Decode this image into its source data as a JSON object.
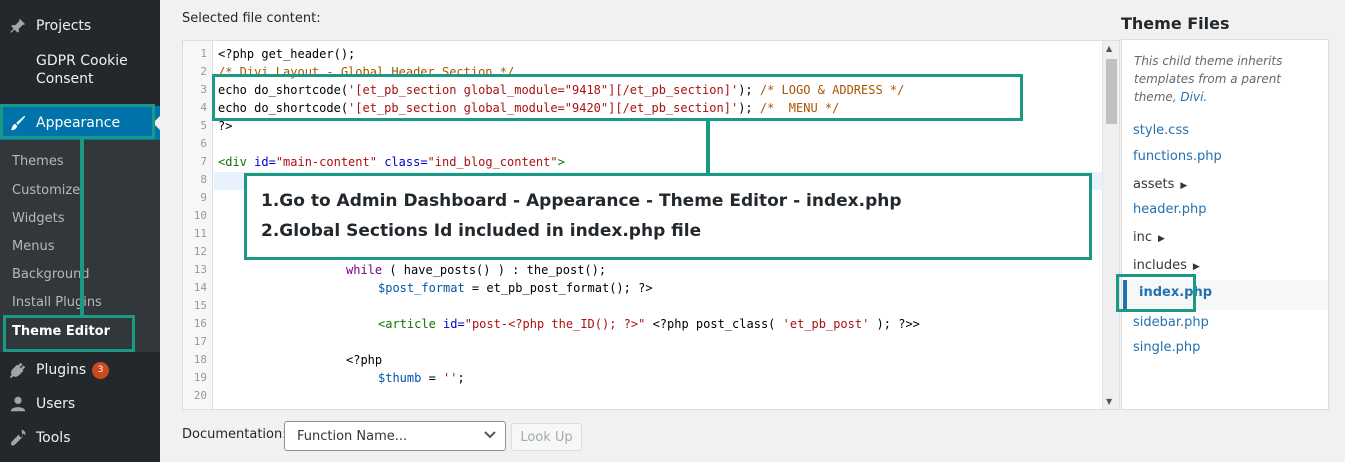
{
  "sidebar": {
    "projects": "Projects",
    "gdpr": "GDPR Cookie Consent",
    "appearance": "Appearance",
    "sub": [
      "Themes",
      "Customize",
      "Widgets",
      "Menus",
      "Background",
      "Install Plugins",
      "Theme Editor"
    ],
    "plugins": "Plugins",
    "plugins_badge": "3",
    "users": "Users",
    "tools": "Tools"
  },
  "editor": {
    "label": "Selected file content:",
    "line_numbers": [
      "1",
      "2",
      "3",
      "4",
      "5",
      "6",
      "7",
      "8",
      "9",
      "10",
      "11",
      "12",
      "13",
      "14",
      "15",
      "16",
      "17",
      "18",
      "19",
      "20"
    ],
    "lines": {
      "l1": "<?php get_header();",
      "l2": "/* Divi Layout - Global Header Section */",
      "l3a": "echo do_shortcode(",
      "l3b": "'[et_pb_section global_module=\"9418\"][/et_pb_section]'",
      "l3c": "); ",
      "l3d": "/* LOGO & ADDRESS */",
      "l4a": "echo do_shortcode(",
      "l4b": "'[et_pb_section global_module=\"9420\"][/et_pb_section]'",
      "l4c": "); ",
      "l4d": "/*  MENU */",
      "l5": "?>",
      "l7a": "<div ",
      "l7b": "id=",
      "l7c": "\"main-content\"",
      "l7d": " class=",
      "l7e": "\"ind_blog_content\"",
      "l7f": ">",
      "l13a": "while",
      "l13b": " ( have_posts() ) : the_post();",
      "l14a": "$post_format",
      "l14b": " = et_pb_post_format(); ?>",
      "l16a": "<article ",
      "l16b": "id=",
      "l16c": "\"post-<?php the_ID(); ?>\"",
      "l16d": " <?php post_class( ",
      "l16e": "'et_pb_post'",
      "l16f": " ); ?>>",
      "l18": "<?php",
      "l19a": "$thumb",
      "l19b": " = ",
      "l19c": "''",
      "l19d": ";"
    }
  },
  "callout": {
    "line1": "1.Go to Admin Dashboard - Appearance - Theme Editor - index.php",
    "line2": "2.Global Sections Id included in index.php file"
  },
  "documentation": {
    "label": "Documentation:",
    "select_value": "Function Name...",
    "button": "Look Up"
  },
  "theme_files": {
    "title": "Theme Files",
    "note": "This child theme inherits templates from a parent theme,",
    "note_link": "Divi.",
    "files": [
      "style.css",
      "functions.php",
      "assets",
      "header.php",
      "inc",
      "includes",
      "index.php",
      "sidebar.php",
      "single.php"
    ]
  },
  "colors": {
    "highlight": "#1a9a85",
    "active_menu": "#0073aa",
    "link": "#2271b1"
  }
}
